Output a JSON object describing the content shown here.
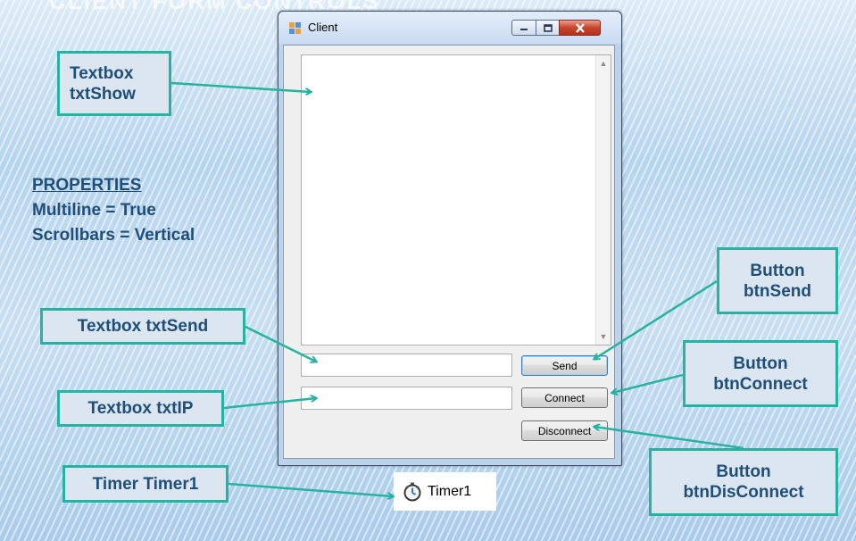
{
  "slide": {
    "header_fragment": "CLIENT FORM CONTROLS"
  },
  "window": {
    "title": "Client",
    "buttons": {
      "send": "Send",
      "connect": "Connect",
      "disconnect": "Disconnect"
    },
    "timer": "Timer1"
  },
  "callouts": {
    "txtshow": [
      "Textbox",
      "txtShow"
    ],
    "txtsend": "Textbox txtSend",
    "txtip": "Textbox txtIP",
    "timer": "Timer Timer1",
    "btnsend": [
      "Button",
      "btnSend"
    ],
    "btnconnect": [
      "Button",
      "btnConnect"
    ],
    "btndisconnect": [
      "Button",
      "btnDisConnect"
    ]
  },
  "properties": {
    "heading": "PROPERTIES",
    "lines": [
      "Multiline = True",
      "Scrollbars = Vertical"
    ]
  },
  "colors": {
    "callout_border": "#26b3a0",
    "callout_text": "#1f4e79",
    "arrow": "#26b3a0"
  }
}
